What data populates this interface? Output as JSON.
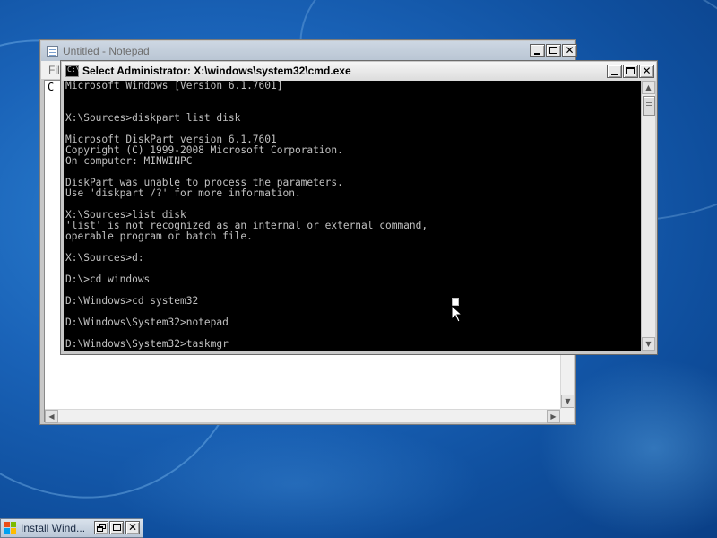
{
  "notepad": {
    "title": "Untitled - Notepad",
    "menu_file": "Fil",
    "edit_text": "C"
  },
  "cmd": {
    "title": "Select Administrator: X:\\windows\\system32\\cmd.exe",
    "icon_text": "C:\\",
    "lines": [
      "Microsoft Windows [Version 6.1.7601]",
      "",
      "",
      "X:\\Sources>diskpart list disk",
      "",
      "Microsoft DiskPart version 6.1.7601",
      "Copyright (C) 1999-2008 Microsoft Corporation.",
      "On computer: MINWINPC",
      "",
      "DiskPart was unable to process the parameters.",
      "Use 'diskpart /?' for more information.",
      "",
      "X:\\Sources>list disk",
      "'list' is not recognized as an internal or external command,",
      "operable program or batch file.",
      "",
      "X:\\Sources>d:",
      "",
      "D:\\>cd windows",
      "",
      "D:\\Windows>cd system32",
      "",
      "D:\\Windows\\System32>notepad",
      "",
      "D:\\Windows\\System32>taskmgr"
    ]
  },
  "installer": {
    "title": "Install Wind..."
  },
  "icons": {
    "close_glyph": "✕",
    "arrow_up": "▲",
    "arrow_down": "▼",
    "arrow_left": "◀",
    "arrow_right": "▶"
  },
  "colors": {
    "console_bg": "#000000",
    "console_text": "#c0c0c0",
    "desktop": "#1a63b8"
  }
}
